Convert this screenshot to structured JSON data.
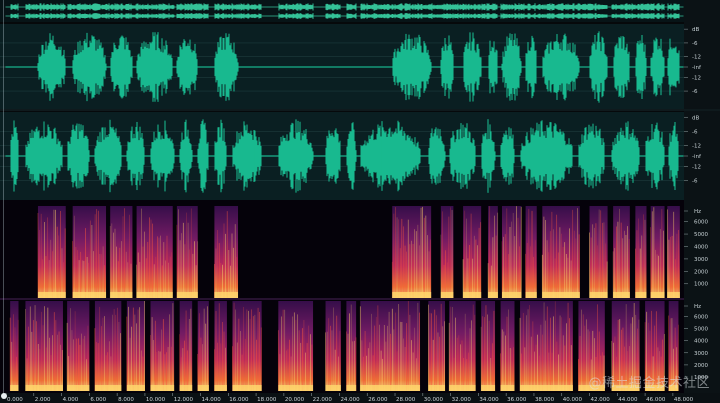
{
  "editor": {
    "view": "waveform-spectral",
    "colors": {
      "waveform": "#19b98f",
      "waveform_bg": "#0a1f22",
      "overview": "#3ad6a8",
      "spectral_low": "#120318",
      "spectral_mid": "#c2306b",
      "spectral_high": "#ffd36a",
      "ruler_bg": "#0b1215"
    },
    "amp_ruler_top": [
      "dB",
      "-6",
      "-12",
      "-inf",
      "-12",
      "-6"
    ],
    "amp_ruler_bottom": [
      "dB",
      "-6",
      "-12",
      "-inf",
      "-12",
      "-6"
    ],
    "freq_ruler_top": [
      "Hz",
      "6000",
      "5000",
      "4000",
      "3000",
      "2000",
      "1000"
    ],
    "freq_ruler_bottom": [
      "Hz",
      "6000",
      "5000",
      "4000",
      "3000",
      "2000",
      "1000"
    ],
    "time_ruler": [
      "0.000",
      "2.000",
      "4.000",
      "6.000",
      "8.000",
      "10.000",
      "12.000",
      "14.000",
      "16.000",
      "18.000",
      "20.000",
      "22.000",
      "24.000",
      "26.000",
      "28.000",
      "30.000",
      "32.000",
      "34.000",
      "36.000",
      "38.000",
      "40.000",
      "42.000",
      "44.000",
      "46.000",
      "48.000"
    ],
    "watermark": "@稀土掘金技术社区",
    "channel_top_segments": [
      [
        2.3,
        4.3
      ],
      [
        4.8,
        7.2
      ],
      [
        7.5,
        9.1
      ],
      [
        9.4,
        12.0
      ],
      [
        12.3,
        13.8
      ],
      [
        15.0,
        16.7
      ],
      [
        27.8,
        30.6
      ],
      [
        31.3,
        32.2
      ],
      [
        32.9,
        34.2
      ],
      [
        34.7,
        35.4
      ],
      [
        35.7,
        37.1
      ],
      [
        37.4,
        38.2
      ],
      [
        38.6,
        41.3
      ],
      [
        42.0,
        43.3
      ],
      [
        43.7,
        44.9
      ],
      [
        45.3,
        46.1
      ],
      [
        46.4,
        47.4
      ],
      [
        47.6,
        48.5
      ]
    ],
    "channel_bottom_segments": [
      [
        0.3,
        0.9
      ],
      [
        1.4,
        4.1
      ],
      [
        4.4,
        6.0
      ],
      [
        6.4,
        8.3
      ],
      [
        8.7,
        10.0
      ],
      [
        10.4,
        12.1
      ],
      [
        12.5,
        13.4
      ],
      [
        13.8,
        14.6
      ],
      [
        15.0,
        15.9
      ],
      [
        16.3,
        18.4
      ],
      [
        19.6,
        22.1
      ],
      [
        23.0,
        24.1
      ],
      [
        24.5,
        25.2
      ],
      [
        25.5,
        29.8
      ],
      [
        30.4,
        31.6
      ],
      [
        31.9,
        33.8
      ],
      [
        34.2,
        35.2
      ],
      [
        35.6,
        36.6
      ],
      [
        37.0,
        40.8
      ],
      [
        41.2,
        43.1
      ],
      [
        43.6,
        45.6
      ],
      [
        46.0,
        47.4
      ],
      [
        47.7,
        48.4
      ]
    ]
  }
}
